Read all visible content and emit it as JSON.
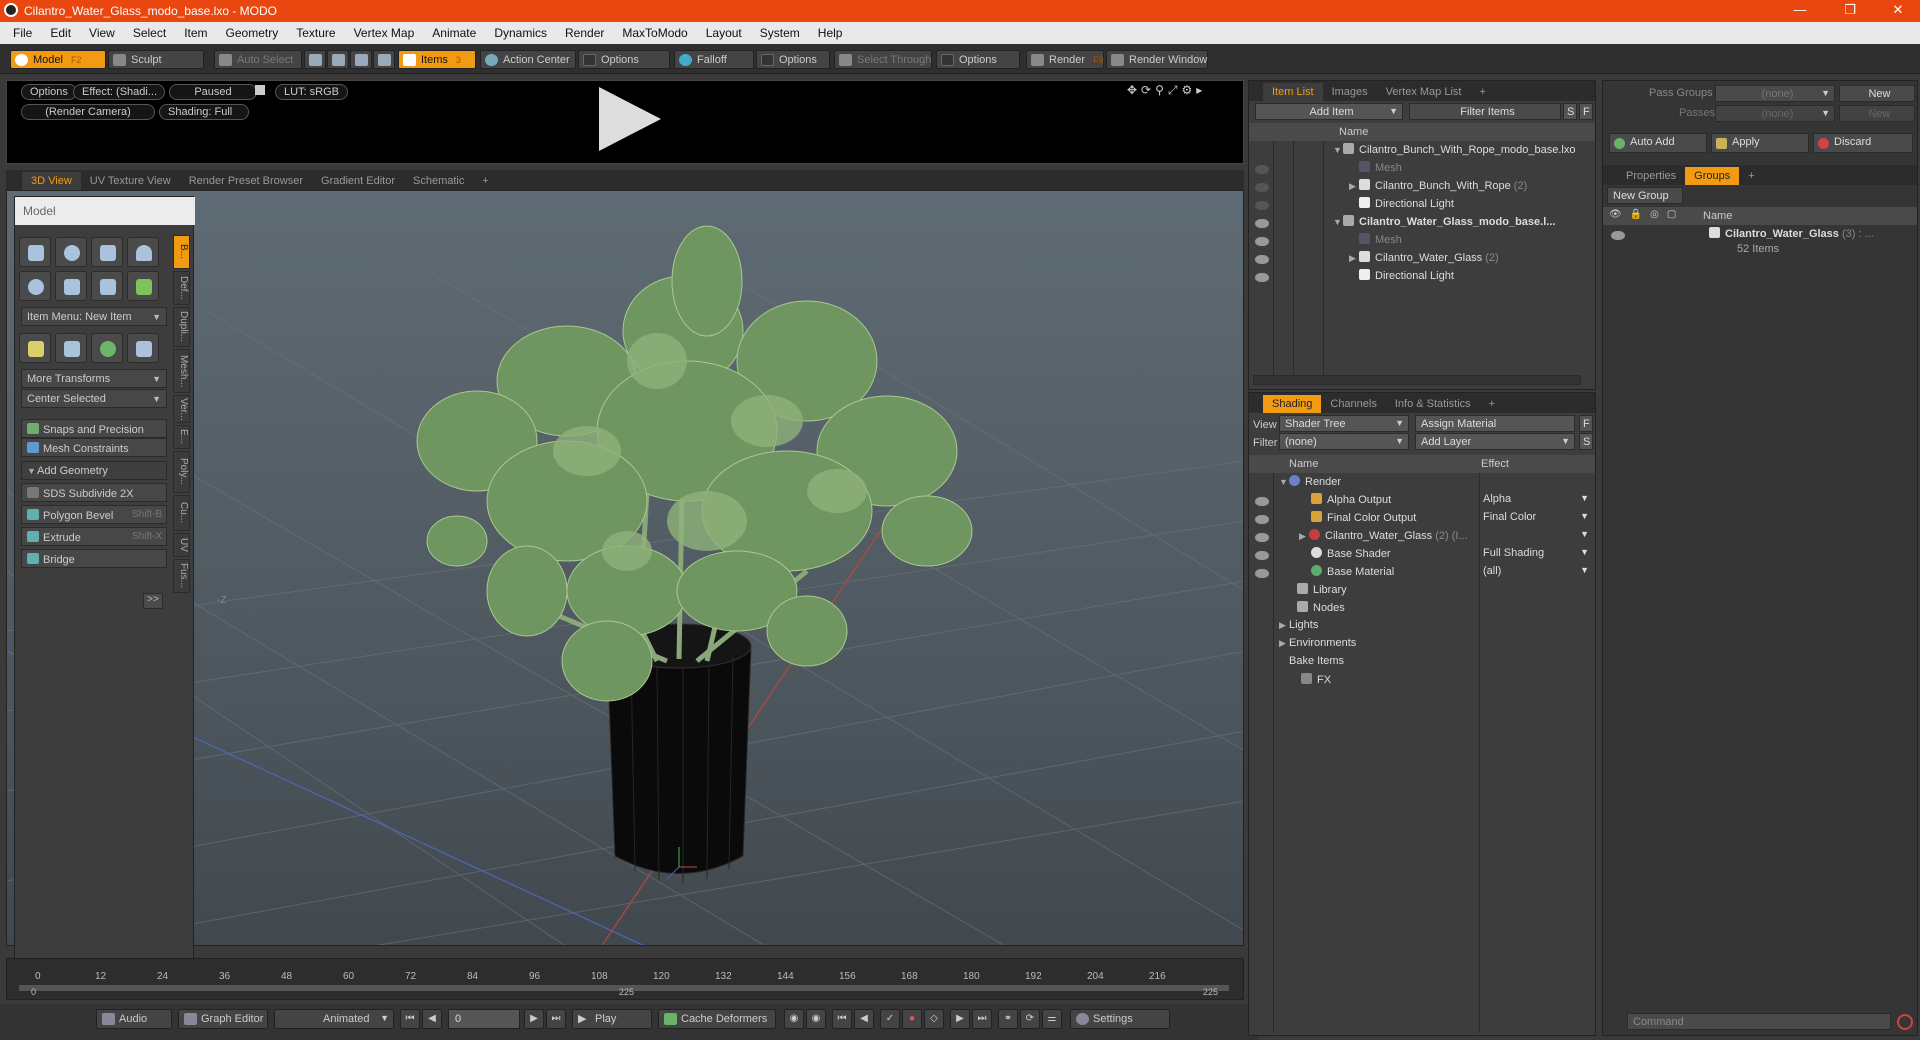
{
  "window": {
    "title": "Cilantro_Water_Glass_modo_base.lxo - MODO",
    "min": "—",
    "max": "❐",
    "close": "✕"
  },
  "menu": [
    "File",
    "Edit",
    "View",
    "Select",
    "Item",
    "Geometry",
    "Texture",
    "Vertex Map",
    "Animate",
    "Dynamics",
    "Render",
    "MaxToModo",
    "Layout",
    "System",
    "Help"
  ],
  "toolbar": {
    "model": "Model",
    "model_key": "F2",
    "sculpt": "Sculpt",
    "auto_select": "Auto Select",
    "items": "Items",
    "items_key": "3",
    "action_center": "Action Center",
    "options1": "Options",
    "falloff": "Falloff",
    "options2": "Options",
    "select_through": "Select Through",
    "options3": "Options",
    "render": "Render",
    "render_key": "F9",
    "render_window": "Render Window"
  },
  "preview": {
    "options": "Options",
    "effect": "Effect: (Shadi...",
    "paused": "Paused",
    "lut": "LUT: sRGB",
    "camera": "(Render Camera)",
    "shading": "Shading: Full"
  },
  "viewtabs": [
    "3D View",
    "UV Texture View",
    "Render Preset Browser",
    "Gradient Editor",
    "Schematic"
  ],
  "tools": {
    "title": "Model",
    "item_menu": "Item Menu: New Item",
    "more_transforms": "More Transforms",
    "center_selected": "Center Selected",
    "snaps": "Snaps and Precision",
    "mesh_constraints": "Mesh Constraints",
    "add_geometry": "Add Geometry",
    "sds": "SDS Subdivide 2X",
    "bevel": "Polygon Bevel",
    "bevel_key": "Shift-B",
    "extrude": "Extrude",
    "extrude_key": "Shift-X",
    "bridge": "Bridge",
    "more": ">>",
    "vtabs": [
      "B...",
      "Def...",
      "Dupli...",
      "Mesh...",
      "Ver...",
      "E...",
      "Poly...",
      "Cu...",
      "UV",
      "Fus..."
    ]
  },
  "viewport": {
    "axis_label": "-Z"
  },
  "timeline": {
    "ticks": [
      "0",
      "12",
      "24",
      "36",
      "48",
      "60",
      "72",
      "84",
      "96",
      "108",
      "120",
      "132",
      "144",
      "156",
      "168",
      "180",
      "192",
      "204",
      "216"
    ],
    "start": "0",
    "mid": "225",
    "end": "225"
  },
  "bottom": {
    "audio": "Audio",
    "graph_editor": "Graph Editor",
    "animated": "Animated",
    "frame": "0",
    "play": "Play",
    "cache": "Cache Deformers",
    "settings": "Settings"
  },
  "itemlist": {
    "tabs": [
      "Item List",
      "Images",
      "Vertex Map List"
    ],
    "add_item": "Add Item",
    "filter": "Filter Items",
    "s": "S",
    "f": "F",
    "col_name": "Name",
    "rows": [
      {
        "label": "Cilantro_Bunch_With_Rope_modo_base.lxo",
        "suffix": ""
      },
      {
        "label": "Mesh",
        "suffix": ""
      },
      {
        "label": "Cilantro_Bunch_With_Rope",
        "suffix": " (2)"
      },
      {
        "label": "Directional Light",
        "suffix": ""
      },
      {
        "label": "Cilantro_Water_Glass_modo_base.l...",
        "suffix": ""
      },
      {
        "label": "Mesh",
        "suffix": ""
      },
      {
        "label": "Cilantro_Water_Glass",
        "suffix": " (2)"
      },
      {
        "label": "Directional Light",
        "suffix": ""
      }
    ]
  },
  "shading": {
    "tabs": [
      "Shading",
      "Channels",
      "Info & Statistics"
    ],
    "view_label": "View",
    "view_value": "Shader Tree",
    "assign": "Assign Material",
    "filter_label": "Filter",
    "filter_value": "(none)",
    "add_layer": "Add Layer",
    "s": "S",
    "f": "F",
    "col_name": "Name",
    "col_effect": "Effect",
    "rows": [
      {
        "label": "Render",
        "effect": ""
      },
      {
        "label": "Alpha Output",
        "effect": "Alpha"
      },
      {
        "label": "Final Color Output",
        "effect": "Final Color"
      },
      {
        "label": "Cilantro_Water_Glass",
        "extra": " (2) (I...",
        "effect": ""
      },
      {
        "label": "Base Shader",
        "effect": "Full Shading"
      },
      {
        "label": "Base Material",
        "effect": "(all)"
      },
      {
        "label": "Library",
        "effect": ""
      },
      {
        "label": "Nodes",
        "effect": ""
      },
      {
        "label": "Lights",
        "effect": ""
      },
      {
        "label": "Environments",
        "effect": ""
      },
      {
        "label": "Bake Items",
        "effect": ""
      },
      {
        "label": "FX",
        "effect": ""
      }
    ]
  },
  "passes": {
    "pass_groups_label": "Pass Groups",
    "pass_groups_value": "(none)",
    "new": "New",
    "passes_label": "Passes",
    "passes_value": "(none)",
    "new2": "New",
    "auto_add": "Auto Add",
    "apply": "Apply",
    "discard": "Discard"
  },
  "groups": {
    "tabs": [
      "Properties",
      "Groups"
    ],
    "new_group": "New Group",
    "col_name": "Name",
    "group_name": "Cilantro_Water_Glass",
    "group_count": " (3) : ...",
    "items": "52 Items"
  },
  "command": {
    "placeholder": "Command"
  }
}
